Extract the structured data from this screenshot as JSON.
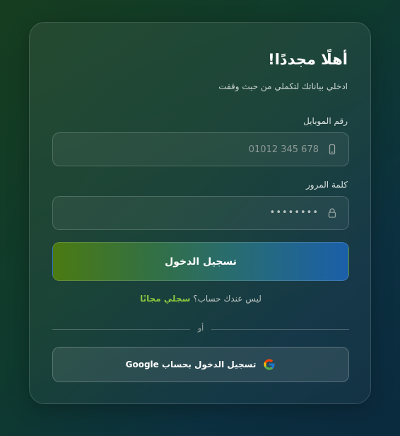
{
  "login": {
    "title": "أهلًا مجددًا!",
    "subtitle": "ادخلي بياناتك لتكملي من حيث وقفت",
    "phone_label": "رقم الموبايل",
    "phone_placeholder": "01012 345 678",
    "password_label": "كلمة المرور",
    "password_masked": "••••••••",
    "submit_label": "تسجيل الدخول",
    "no_account_text": "ليس عندك حساب؟",
    "signup_link": "سجلي مجانًا",
    "divider_text": "أو",
    "google_label": "تسجيل الدخول بحساب Google"
  },
  "icons": {
    "phone": "phone-icon",
    "password": "lock-icon",
    "google": "google-icon"
  },
  "colors": {
    "accent_green": "#8cc63f",
    "button_gradient_start": "#4b7a12",
    "button_gradient_end": "#1b5fa9",
    "background_start": "#163d1f",
    "background_end": "#0a2a3e"
  }
}
